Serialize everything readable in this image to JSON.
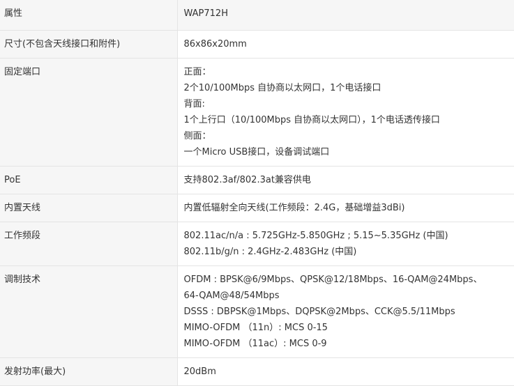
{
  "header": {
    "key": "属性",
    "value": "WAP712H"
  },
  "rows": [
    {
      "key": "尺寸(不包含天线接口和附件)",
      "lines": [
        "86x86x20mm"
      ]
    },
    {
      "key": "固定端口",
      "lines": [
        "正面：",
        "2个10/100Mbps 自协商以太网口，1个电话接口",
        "背面:",
        "1个上行口（10/100Mbps 自协商以太网口），1个电话透传接口",
        "侧面：",
        "一个Micro USB接口，设备调试端口"
      ]
    },
    {
      "key": "PoE",
      "lines": [
        "支持802.3af/802.3at兼容供电"
      ]
    },
    {
      "key": "内置天线",
      "lines": [
        "内置低辐射全向天线(工作频段：2.4G，基础增益3dBi)"
      ]
    },
    {
      "key": "工作频段",
      "lines": [
        "802.11ac/n/a : 5.725GHz-5.850GHz ; 5.15~5.35GHz (中国)",
        "802.11b/g/n : 2.4GHz-2.483GHz (中国)"
      ]
    },
    {
      "key": "调制技术",
      "lines": [
        "OFDM : BPSK@6/9Mbps、QPSK@12/18Mbps、16-QAM@24Mbps、",
        "64-QAM@48/54Mbps",
        "DSSS : DBPSK@1Mbps、DQPSK@2Mbps、CCK@5.5/11Mbps",
        "MIMO-OFDM （11n）: MCS 0-15",
        "MIMO-OFDM （11ac）: MCS 0-9"
      ]
    },
    {
      "key": "发射功率(最大)",
      "lines": [
        "20dBm"
      ]
    }
  ]
}
